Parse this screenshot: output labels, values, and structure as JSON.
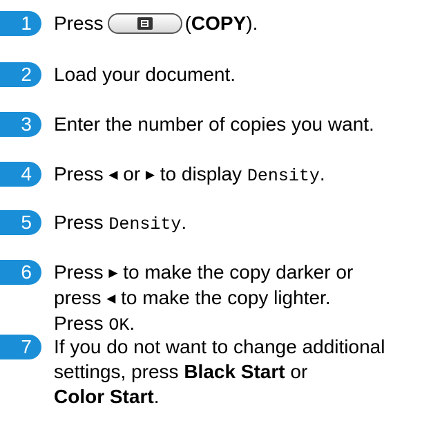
{
  "accent_color": "#1a8fd8",
  "copy_button_icon": "copy-icon",
  "steps": [
    {
      "number": "1",
      "press": "Press",
      "copy_label": "(COPY)"
    },
    {
      "number": "2",
      "text": "Load your document."
    },
    {
      "number": "3",
      "text": "Enter the number of copies you want."
    },
    {
      "number": "4",
      "press": "Press",
      "left_arrow": "◀",
      "or": "or",
      "right_arrow": "▶",
      "to_display": "to display",
      "mode_name": "Density",
      "period": "."
    },
    {
      "number": "5",
      "press": "Press",
      "mode_name": "Density",
      "period": "."
    },
    {
      "number": "6",
      "press": "Press",
      "right_arrow": "▶",
      "line1_rest": "to make the copy darker or",
      "line2_press": "press",
      "left_arrow": "◀",
      "line2_rest": "to make the copy lighter.",
      "line3_press": "Press",
      "ok_label": "OK",
      "period": "."
    },
    {
      "number": "7",
      "line1": "If you do not want to change additional",
      "line2_pre": "settings, press",
      "black_start": "Black Start",
      "or": "or",
      "color_start": "Color Start",
      "period": "."
    }
  ]
}
